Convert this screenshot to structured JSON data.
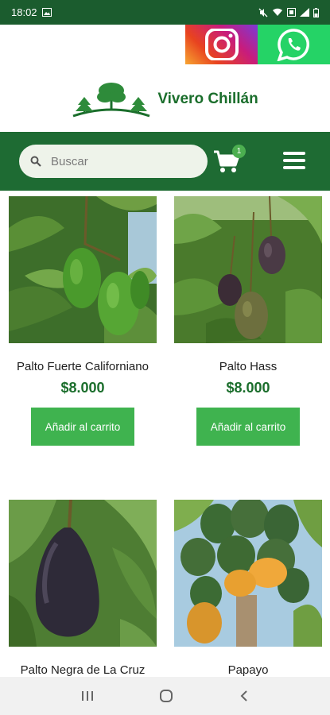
{
  "status_bar": {
    "time": "18:02"
  },
  "social": {
    "instagram_icon": "instagram-icon",
    "whatsapp_icon": "whatsapp-icon"
  },
  "logo": {
    "text": "Vivero Chillán"
  },
  "header": {
    "search_placeholder": "Buscar",
    "cart_count": "1"
  },
  "products": [
    {
      "name": "Palto Fuerte Californiano",
      "price": "$8.000",
      "button": "Añadir al carrito"
    },
    {
      "name": "Palto Hass",
      "price": "$8.000",
      "button": "Añadir al carrito"
    },
    {
      "name": "Palto Negra de La Cruz"
    },
    {
      "name": "Papayo"
    }
  ],
  "colors": {
    "brand_green": "#1e6b33",
    "button_green": "#3fb34f",
    "price_green": "#1b6e2c"
  }
}
